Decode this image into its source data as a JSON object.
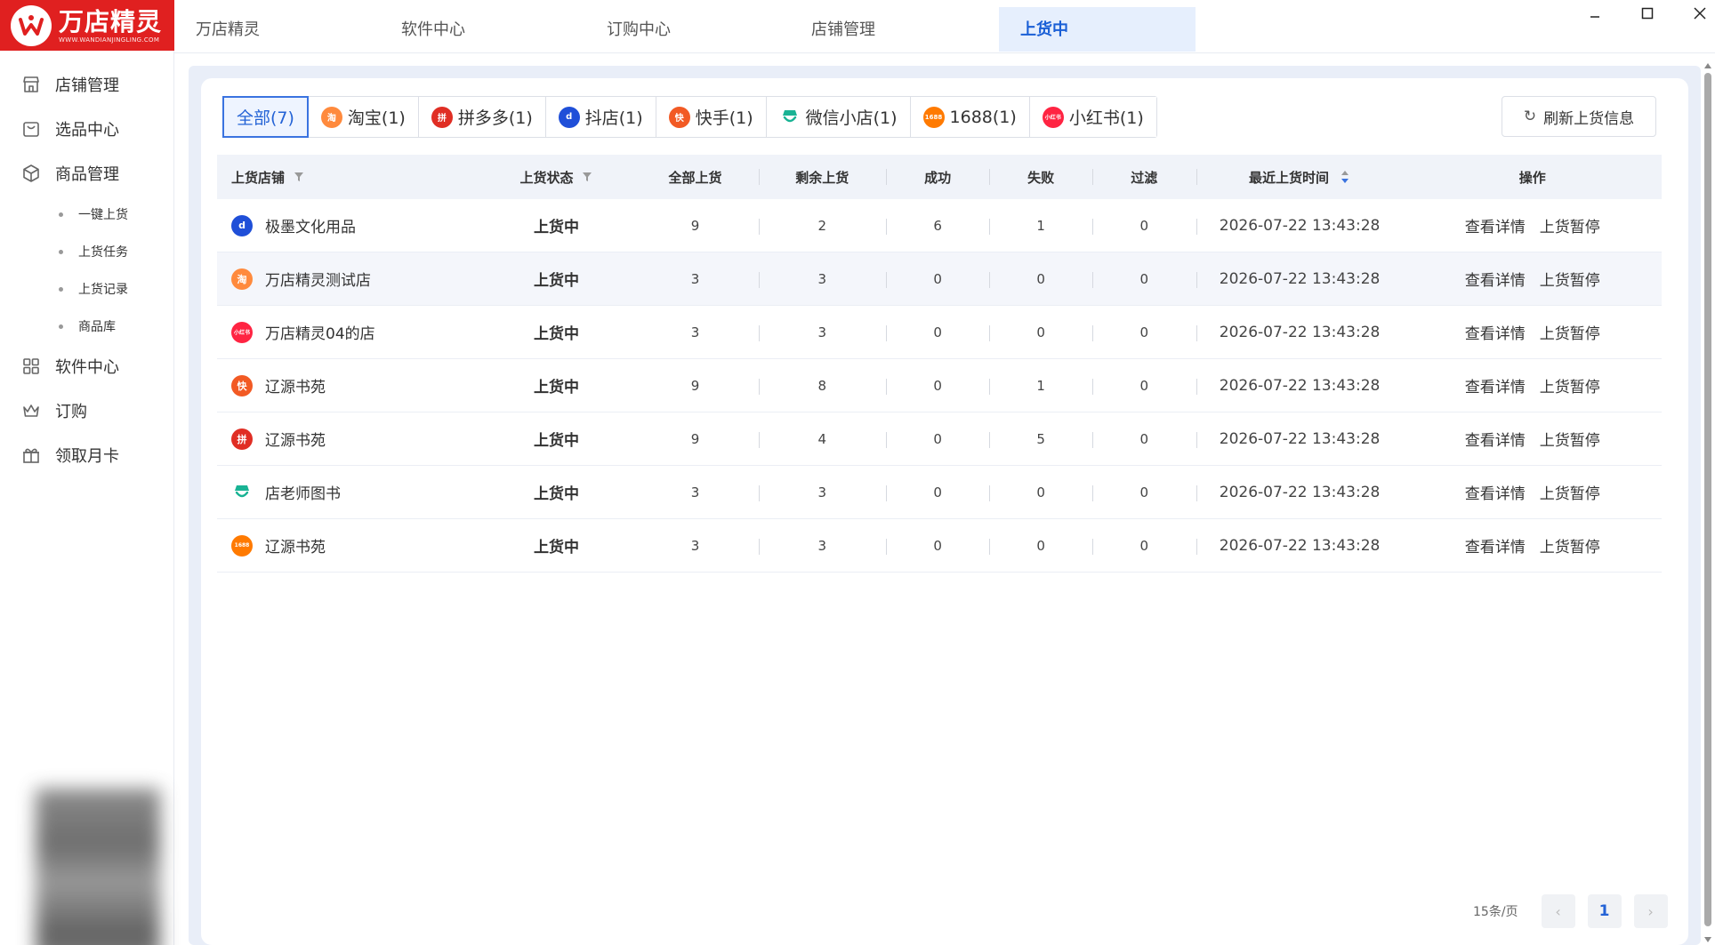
{
  "app": {
    "logo_text": "万店精灵",
    "logo_sub": "WWW.WANDIANJINGLING.COM"
  },
  "top_tabs": [
    {
      "label": "万店精灵"
    },
    {
      "label": "软件中心"
    },
    {
      "label": "订购中心"
    },
    {
      "label": "店铺管理"
    },
    {
      "label": "上货中"
    }
  ],
  "active_top_tab": "上货中",
  "sidebar": {
    "items": [
      {
        "label": "店铺管理",
        "icon": "store-icon"
      },
      {
        "label": "选品中心",
        "icon": "bag-icon"
      },
      {
        "label": "商品管理",
        "icon": "box-icon"
      },
      {
        "label": "软件中心",
        "icon": "grid-icon"
      },
      {
        "label": "订购",
        "icon": "crown-icon"
      },
      {
        "label": "领取月卡",
        "icon": "gift-icon"
      }
    ],
    "sub_items": [
      {
        "label": "一键上货"
      },
      {
        "label": "上货任务"
      },
      {
        "label": "上货记录"
      },
      {
        "label": "商品库"
      }
    ]
  },
  "platform_tabs": [
    {
      "label": "全部(7)",
      "icon": ""
    },
    {
      "label": "淘宝(1)",
      "icon": "taobao-icon",
      "icon_text": "淘",
      "color": "#ff8a3d"
    },
    {
      "label": "拼多多(1)",
      "icon": "pinduoduo-icon",
      "icon_text": "拼",
      "color": "#e02e24"
    },
    {
      "label": "抖店(1)",
      "icon": "doudian-icon",
      "icon_text": "d",
      "color": "#1f4fd8"
    },
    {
      "label": "快手(1)",
      "icon": "kuaishou-icon",
      "icon_text": "快",
      "color": "#f25a24"
    },
    {
      "label": "微信小店(1)",
      "icon": "wechat-shop-icon",
      "icon_text": "",
      "color": "#19b394"
    },
    {
      "label": "1688(1)",
      "icon": "1688-icon",
      "icon_text": "1688",
      "color": "#ff7a00"
    },
    {
      "label": "小红书(1)",
      "icon": "xiaohongshu-icon",
      "icon_text": "小红书",
      "color": "#ff2442"
    }
  ],
  "refresh_label": "刷新上货信息",
  "table": {
    "headers": {
      "shop": "上货店铺",
      "status": "上货状态",
      "total": "全部上货",
      "remaining": "剩余上货",
      "success": "成功",
      "fail": "失败",
      "filtered": "过滤",
      "time": "最近上货时间",
      "ops": "操作"
    },
    "op_detail": "查看详情",
    "op_pause": "上货暂停",
    "rows": [
      {
        "shop": "极墨文化用品",
        "platform": "doudian-icon",
        "icon_text": "d",
        "color": "#1f4fd8",
        "status": "上货中",
        "total": "9",
        "remaining": "2",
        "success": "6",
        "fail": "1",
        "filtered": "0",
        "time": "2026-07-22 13:43:28"
      },
      {
        "shop": "万店精灵测试店",
        "platform": "taobao-icon",
        "icon_text": "淘",
        "color": "#ff8a3d",
        "status": "上货中",
        "total": "3",
        "remaining": "3",
        "success": "0",
        "fail": "0",
        "filtered": "0",
        "time": "2026-07-22 13:43:28"
      },
      {
        "shop": "万店精灵04的店",
        "platform": "xiaohongshu-icon",
        "icon_text": "小红书",
        "color": "#ff2442",
        "status": "上货中",
        "total": "3",
        "remaining": "3",
        "success": "0",
        "fail": "0",
        "filtered": "0",
        "time": "2026-07-22 13:43:28"
      },
      {
        "shop": "辽源书苑",
        "platform": "kuaishou-icon",
        "icon_text": "快",
        "color": "#f25a24",
        "status": "上货中",
        "total": "9",
        "remaining": "8",
        "success": "0",
        "fail": "1",
        "filtered": "0",
        "time": "2026-07-22 13:43:28"
      },
      {
        "shop": "辽源书苑",
        "platform": "pinduoduo-icon",
        "icon_text": "拼",
        "color": "#e02e24",
        "status": "上货中",
        "total": "9",
        "remaining": "4",
        "success": "0",
        "fail": "5",
        "filtered": "0",
        "time": "2026-07-22 13:43:28"
      },
      {
        "shop": "店老师图书",
        "platform": "wechat-shop-icon",
        "icon_text": "",
        "color": "#19b394",
        "status": "上货中",
        "total": "3",
        "remaining": "3",
        "success": "0",
        "fail": "0",
        "filtered": "0",
        "time": "2026-07-22 13:43:28"
      },
      {
        "shop": "辽源书苑",
        "platform": "1688-icon",
        "icon_text": "1688",
        "color": "#ff7a00",
        "status": "上货中",
        "total": "3",
        "remaining": "3",
        "success": "0",
        "fail": "0",
        "filtered": "0",
        "time": "2026-07-22 13:43:28"
      }
    ]
  },
  "pagination": {
    "page_size": "15条/页",
    "current_page": "1"
  },
  "colors": {
    "brand": "#e02020",
    "accent": "#2463d6"
  }
}
